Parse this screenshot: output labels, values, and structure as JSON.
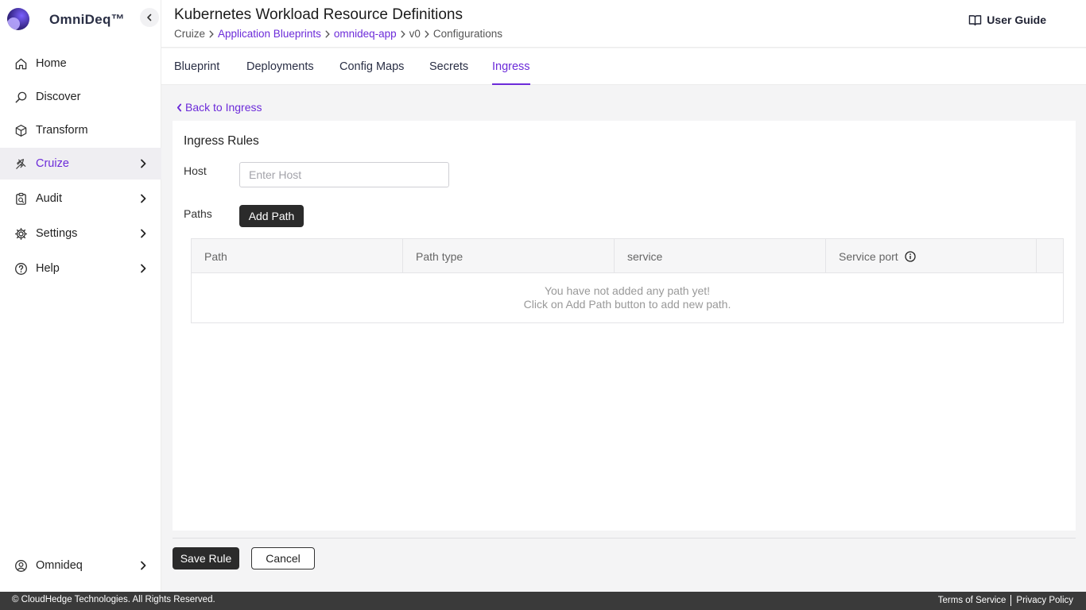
{
  "brand": {
    "name": "OmniDeq™"
  },
  "sidebar": {
    "items": [
      {
        "label": "Home",
        "icon": "home-icon"
      },
      {
        "label": "Discover",
        "icon": "discover-icon"
      },
      {
        "label": "Transform",
        "icon": "cube-icon"
      },
      {
        "label": "Cruize",
        "icon": "cruize-icon",
        "active": true
      },
      {
        "label": "Audit",
        "icon": "clipboard-icon"
      },
      {
        "label": "Settings",
        "icon": "gear-icon"
      },
      {
        "label": "Help",
        "icon": "help-icon"
      }
    ],
    "user": {
      "label": "Omnideq",
      "icon": "user-icon"
    }
  },
  "header": {
    "title": "Kubernetes Workload Resource Definitions",
    "breadcrumb": [
      "Cruize",
      "Application Blueprints",
      "omnideq-app",
      "v0",
      "Configurations"
    ],
    "user_guide": "User Guide"
  },
  "tabs": [
    "Blueprint",
    "Deployments",
    "Config Maps",
    "Secrets",
    "Ingress"
  ],
  "active_tab": "Ingress",
  "back_link": "Back to Ingress",
  "form": {
    "title": "Ingress Rules",
    "host_label": "Host",
    "host_placeholder": "Enter Host",
    "host_value": "",
    "paths_label": "Paths",
    "add_path_label": "Add Path"
  },
  "table": {
    "columns": [
      "Path",
      "Path type",
      "service",
      "Service port",
      ""
    ],
    "empty_line1": "You have not added any path yet!",
    "empty_line2": "Click on Add Path button to add new path."
  },
  "actions": {
    "save_label": "Save Rule",
    "cancel_label": "Cancel"
  },
  "footer": {
    "copyright": "© CloudHedge Technologies. All Rights Reserved.",
    "terms": "Terms of Service",
    "privacy": "Privacy Policy"
  },
  "colors": {
    "accent": "#6c2bd9",
    "dark_button": "#2b2b2b",
    "footer_bg": "#3a3a3a"
  }
}
